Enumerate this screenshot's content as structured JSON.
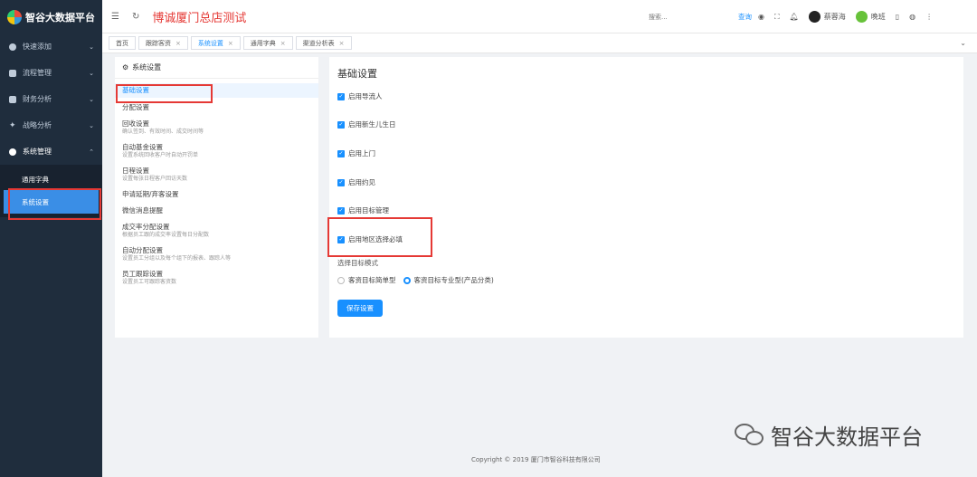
{
  "app": {
    "title": "智谷大数据平台"
  },
  "sidebar": {
    "items": [
      {
        "label": "快速添加",
        "icon": "plus-circle-icon"
      },
      {
        "label": "流程管理",
        "icon": "flow-icon"
      },
      {
        "label": "财务分析",
        "icon": "finance-icon"
      },
      {
        "label": "战略分析",
        "icon": "strategy-icon"
      },
      {
        "label": "系统管理",
        "icon": "gear-icon"
      }
    ],
    "subitems": [
      {
        "label": "通用字典"
      },
      {
        "label": "系统设置"
      }
    ]
  },
  "topbar": {
    "store_title": "博诚厦门总店测试",
    "search_placeholder": "搜索...",
    "search_label": "查询",
    "users": [
      "蔡蓉海",
      "晚班"
    ]
  },
  "tabs": [
    {
      "label": "首页"
    },
    {
      "label": "跟踪客资"
    },
    {
      "label": "系统设置"
    },
    {
      "label": "通用字典"
    },
    {
      "label": "渠道分析表"
    }
  ],
  "settings_menu": {
    "title": "系统设置",
    "items": [
      {
        "name": "基础设置",
        "desc": ""
      },
      {
        "name": "分配设置",
        "desc": ""
      },
      {
        "name": "回收设置",
        "desc": "确认签到、有效时间、成交时间等"
      },
      {
        "name": "自动基金设置",
        "desc": "设置系统回收客户时自动开罚单"
      },
      {
        "name": "日程设置",
        "desc": "设置每张日程客户回访天数"
      },
      {
        "name": "申请延期/弃客设置",
        "desc": ""
      },
      {
        "name": "微信消息提醒",
        "desc": ""
      },
      {
        "name": "成交率分配设置",
        "desc": "根据员工跟的成交率设置每日分配数"
      },
      {
        "name": "自动分配设置",
        "desc": "设置员工分组以及每个组下的报表、跟踪人等"
      },
      {
        "name": "员工跟踪设置",
        "desc": "设置员工可跟踪客资数"
      }
    ]
  },
  "basic_settings": {
    "title": "基础设置",
    "checkboxes": [
      {
        "label": "启用导流人",
        "checked": true
      },
      {
        "label": "启用新生儿生日",
        "checked": true
      },
      {
        "label": "启用上门",
        "checked": true
      },
      {
        "label": "启用约见",
        "checked": true
      },
      {
        "label": "启用目标管理",
        "checked": true
      },
      {
        "label": "启用地区选择必填",
        "checked": true
      }
    ],
    "mode_label": "选择目标模式",
    "radios": [
      {
        "label": "客资目标简单型",
        "selected": false
      },
      {
        "label": "客资目标专业型(产品分类)",
        "selected": true
      }
    ],
    "save_label": "保存设置"
  },
  "footer": {
    "copyright": "Copyright © 2019 厦门市智谷科技有限公司"
  },
  "watermark": {
    "text": "智谷大数据平台"
  },
  "colors": {
    "sidebar_bg": "#1f2d3d",
    "accent": "#1890ff",
    "highlight_red": "#e53935"
  }
}
